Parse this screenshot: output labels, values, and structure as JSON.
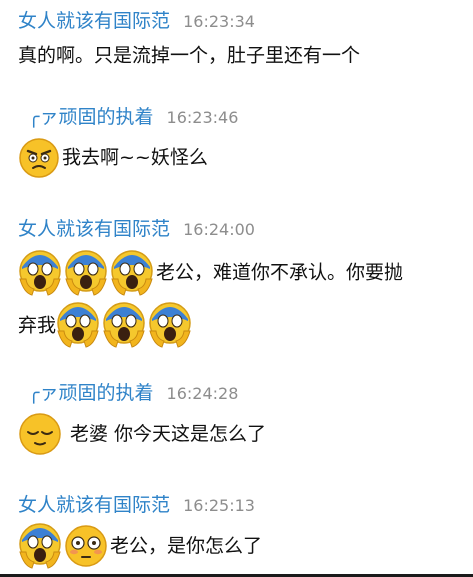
{
  "chat": {
    "messages": [
      {
        "sender": "女人就该有国际范",
        "time": "16:23:34",
        "text": "真的啊。只是流掉一个，肚子里还有一个"
      },
      {
        "sender": "╭ァ顽固的执着",
        "time": "16:23:46",
        "text": "我去啊~~妖怪么"
      },
      {
        "sender": "女人就该有国际范",
        "time": "16:24:00",
        "text": "老公，难道你不承认。你要抛",
        "text2": "弃我"
      },
      {
        "sender": "╭ァ顽固的执着",
        "time": "16:24:28",
        "text": "老婆 你今天这是怎么了"
      },
      {
        "sender": "女人就该有国际范",
        "time": "16:25:13",
        "text": "老公，是你怎么了"
      }
    ]
  },
  "emoji_icons": [
    "angry-face-icon",
    "scream-face-icon",
    "relieved-face-icon",
    "flushed-face-icon"
  ],
  "colors": {
    "sender_name": "#2f83c8",
    "timestamp": "#8d8d8d",
    "text": "#111111",
    "emoji_face": "#f7c228"
  }
}
